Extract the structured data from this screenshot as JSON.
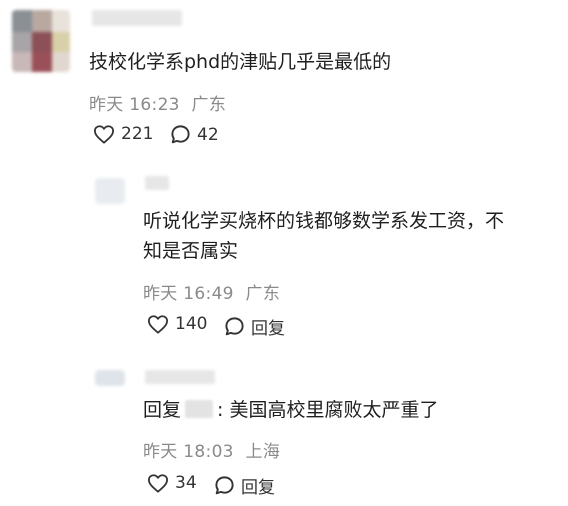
{
  "comments": [
    {
      "text": "技校化学系phd的津贴几乎是最低的",
      "time": "昨天 16:23",
      "location": "广东",
      "likes": "221",
      "replies": "42"
    },
    {
      "text_line1": "听说化学买烧杯的钱都够数学系发工资，不",
      "text_line2": "知是否属实",
      "time": "昨天 16:49",
      "location": "广东",
      "likes": "140",
      "reply_label": "回复"
    },
    {
      "reply_prefix": "回复",
      "text": ": 美国高校里腐败太严重了",
      "time": "昨天 18:03",
      "location": "上海",
      "likes": "34",
      "reply_label": "回复"
    }
  ]
}
